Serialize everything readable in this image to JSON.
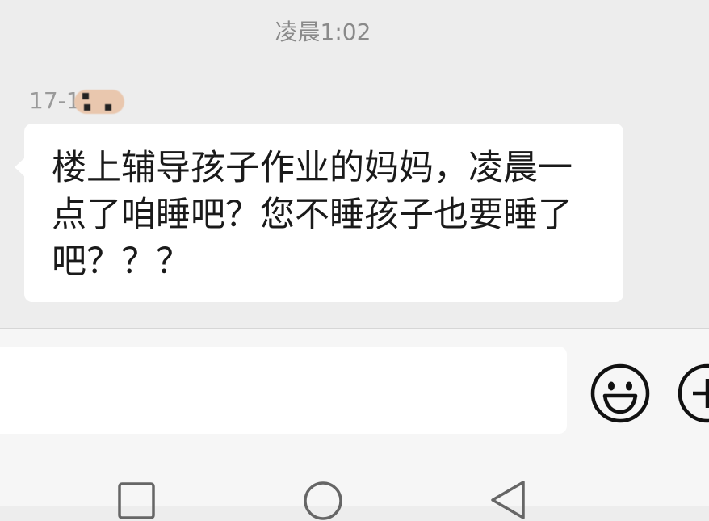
{
  "chat": {
    "timestamp": "凌晨1:02",
    "sender_prefix": "17-1",
    "message": "楼上辅导孩子作业的妈妈，凌晨一点了咱睡吧？您不睡孩子也要睡了吧？？？"
  },
  "input_bar": {
    "placeholder": "",
    "emoji_icon": "smiley-face-icon",
    "plus_icon": "plus-circle-icon"
  },
  "nav": {
    "recent_icon": "square-icon",
    "home_icon": "circle-icon",
    "back_icon": "triangle-back-icon"
  },
  "colors": {
    "background": "#ededed",
    "bubble": "#ffffff",
    "timestamp_text": "#8a8a8a",
    "message_text": "#1a1a1a"
  }
}
